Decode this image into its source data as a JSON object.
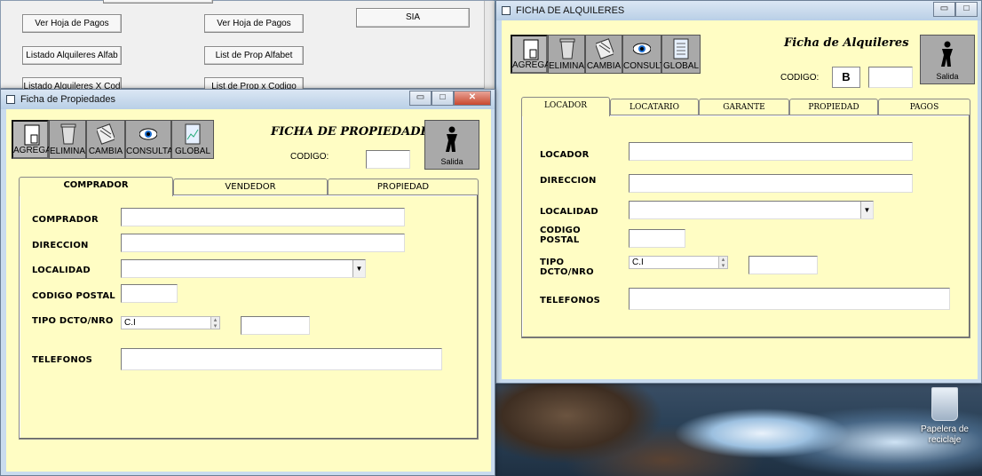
{
  "menu_window": {
    "buttons": [
      "Ver Hoja de Pagos",
      "Ver Hoja de Pagos",
      "SIA",
      "Listado Alquileres Alfab",
      "List de Prop Alfabet",
      "Listado Alquileres X Cod",
      "List de Prop x Codigo"
    ]
  },
  "propiedades": {
    "window_title": "Ficha de Propiedades",
    "toolbar": [
      "AGREGA",
      "ELIMINA",
      "CAMBIA",
      "CONSULTA",
      "GLOBAL"
    ],
    "heading": "FICHA DE PROPIEDADES",
    "codigo_label": "CODIGO:",
    "codigo_value": "",
    "salida_label": "Salida",
    "tabs": [
      "COMPRADOR",
      "VENDEDOR",
      "PROPIEDAD"
    ],
    "active_tab": 0,
    "fields": {
      "comprador": {
        "label": "COMPRADOR",
        "value": ""
      },
      "direccion": {
        "label": "DIRECCION",
        "value": ""
      },
      "localidad": {
        "label": "LOCALIDAD",
        "value": ""
      },
      "codigo_postal": {
        "label": "CODIGO POSTAL",
        "value": ""
      },
      "tipo_dcto": {
        "label": "TIPO DCTO/NRO",
        "type_value": "C.I",
        "nro_value": ""
      },
      "telefonos": {
        "label": "TELEFONOS",
        "value": ""
      }
    }
  },
  "alquileres": {
    "window_title": "FICHA DE ALQUILERES",
    "toolbar": [
      "AGREGA",
      "ELIMINA",
      "CAMBIA",
      "CONSULTA",
      "GLOBAL"
    ],
    "heading": "Ficha de Alquileres",
    "codigo_label": "CODIGO:",
    "codigo_letter": "B",
    "codigo_value": "",
    "salida_label": "Salida",
    "tabs": [
      "LOCADOR",
      "LOCATARIO",
      "GARANTE",
      "PROPIEDAD",
      "PAGOS"
    ],
    "active_tab": 0,
    "fields": {
      "locador": {
        "label": "LOCADOR",
        "value": ""
      },
      "direccion": {
        "label": "DIRECCION",
        "value": ""
      },
      "localidad": {
        "label": "LOCALIDAD",
        "value": ""
      },
      "codigo_postal_1": "CODIGO",
      "codigo_postal_2": "POSTAL",
      "codigo_postal_value": "",
      "tipo_1": "TIPO",
      "tipo_2": "DCTO/NRO",
      "tipo_value": "C.I",
      "nro_value": "",
      "telefonos": {
        "label": "TELEFONOS",
        "value": ""
      }
    }
  },
  "desktop": {
    "recycle_bin_line1": "Papelera de",
    "recycle_bin_line2": "reciclaje"
  }
}
